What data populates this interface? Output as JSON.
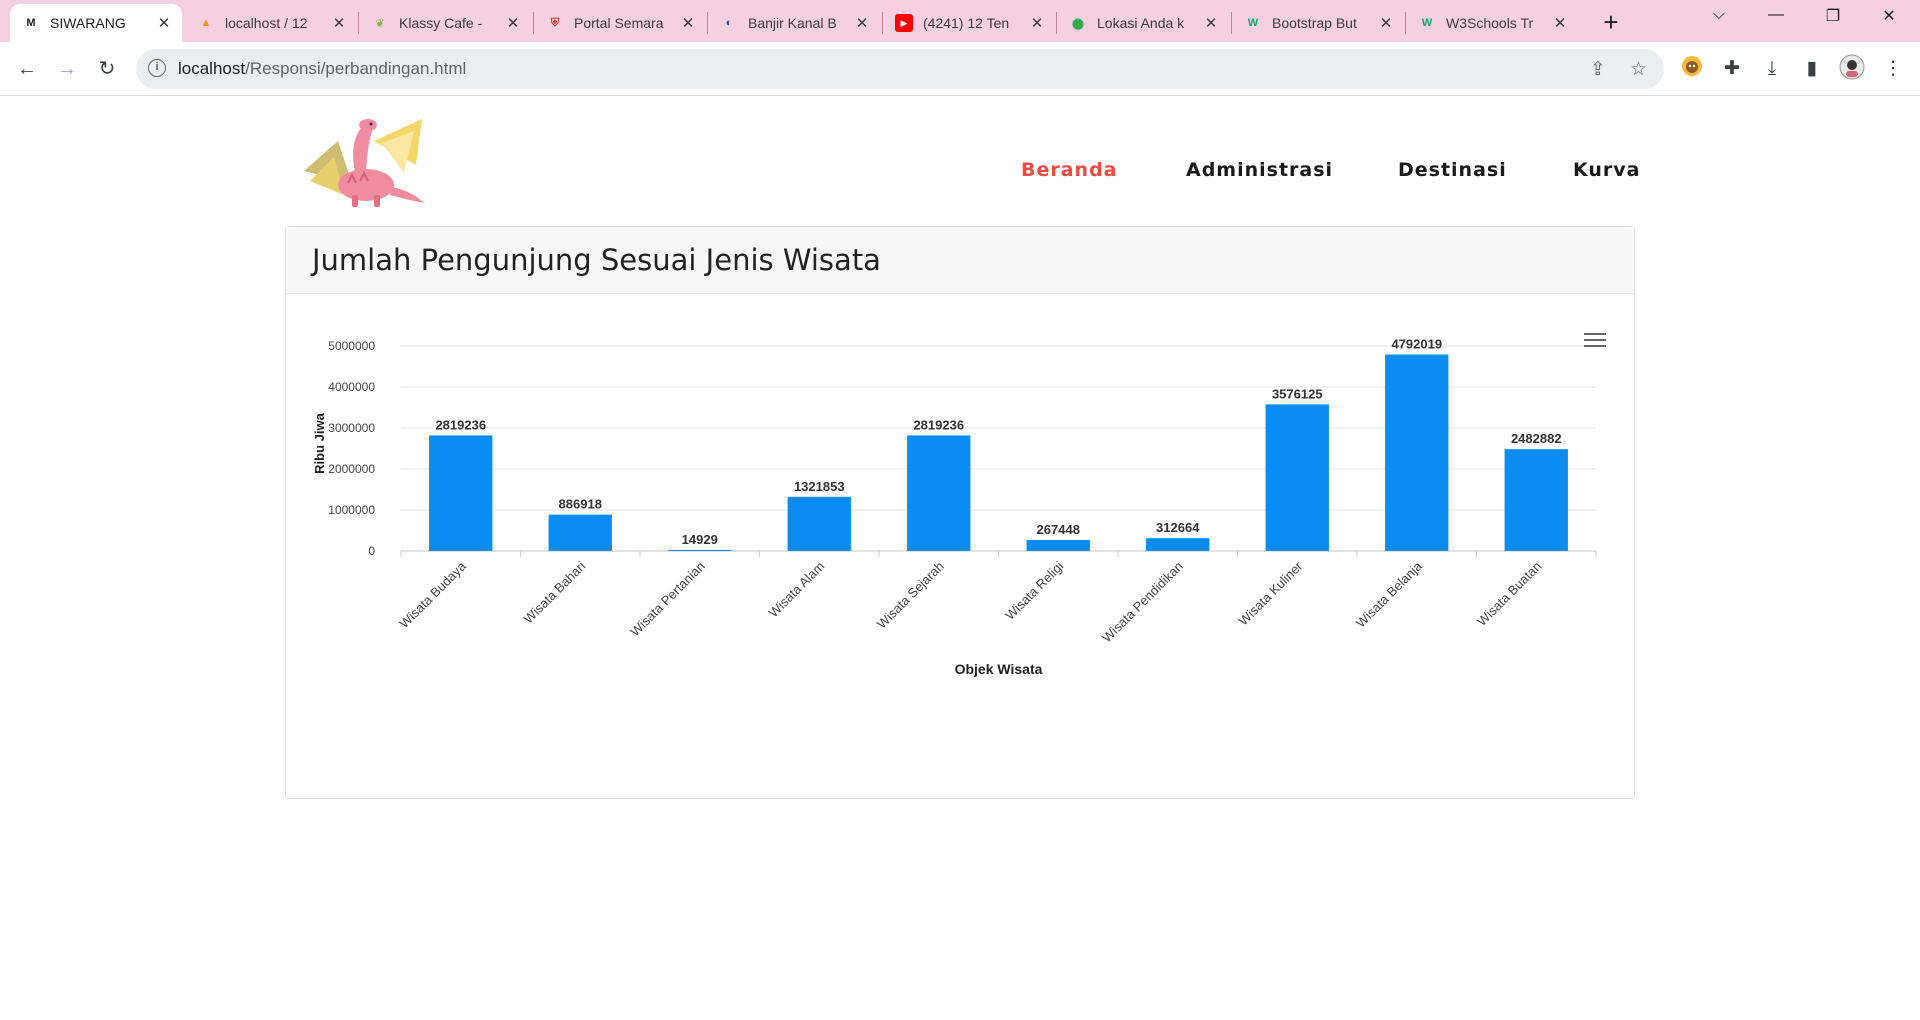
{
  "browser": {
    "tabs": [
      {
        "title": "SIWARANG",
        "icon": "m-logo-icon",
        "color": "#222222",
        "active": true
      },
      {
        "title": "localhost / 12",
        "icon": "phpmyadmin-icon",
        "color": "#f29111",
        "active": false
      },
      {
        "title": "Klassy Cafe - ",
        "icon": "leaf-icon",
        "color": "#7cb342",
        "active": false
      },
      {
        "title": "Portal Semara",
        "icon": "crest-icon",
        "color": "#c0392b",
        "active": false
      },
      {
        "title": "Banjir Kanal B",
        "icon": "globe-icon",
        "color": "#1a4c8a",
        "active": false
      },
      {
        "title": "(4241) 12 Ten",
        "icon": "youtube-icon",
        "color": "#ff0000",
        "active": false
      },
      {
        "title": "Lokasi Anda k",
        "icon": "maps-pin-icon",
        "color": "#34a853",
        "active": false
      },
      {
        "title": "Bootstrap But",
        "icon": "w3schools-icon",
        "color": "#04aa6d",
        "active": false
      },
      {
        "title": "W3Schools Tr",
        "icon": "w3schools-icon",
        "color": "#04aa6d",
        "active": false
      }
    ],
    "url_host": "localhost",
    "url_path": "/Responsi/perbandingan.html"
  },
  "nav": {
    "items": [
      {
        "label": "Beranda",
        "active": true
      },
      {
        "label": "Administrasi",
        "active": false
      },
      {
        "label": "Destinasi",
        "active": false
      },
      {
        "label": "Kurva",
        "active": false
      }
    ]
  },
  "card": {
    "title": "Jumlah Pengunjung Sesuai Jenis Wisata"
  },
  "chart_data": {
    "type": "bar",
    "title": "",
    "xlabel": "Objek Wisata",
    "ylabel": "Ribu Jiwa",
    "ylim": [
      0,
      5000000
    ],
    "yticks": [
      0,
      1000000,
      2000000,
      3000000,
      4000000,
      5000000
    ],
    "grid": true,
    "bar_color": "#0a8cf3",
    "categories": [
      "Wisata Budaya",
      "Wisata Bahari",
      "Wisata Pertanian",
      "Wisata Alam",
      "Wisata Sejarah",
      "Wisata Religi",
      "Wisata Pendidikan",
      "Wisata Kuliner",
      "Wisata Belanja",
      "Wisata Buatan"
    ],
    "values": [
      2819236,
      886918,
      14929,
      1321853,
      2819236,
      267448,
      312664,
      3576125,
      4792019,
      2482882
    ]
  }
}
